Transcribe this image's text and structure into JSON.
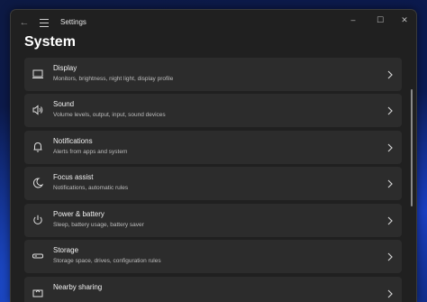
{
  "window": {
    "title": "Settings",
    "back_glyph": "←",
    "min_glyph": "–",
    "max_glyph": "☐",
    "close_glyph": "✕"
  },
  "page": {
    "title": "System"
  },
  "items": [
    {
      "title": "Display",
      "subtitle": "Monitors, brightness, night light, display profile",
      "icon": "display-icon"
    },
    {
      "title": "Sound",
      "subtitle": "Volume levels, output, input, sound devices",
      "icon": "speaker-icon"
    },
    {
      "title": "Notifications",
      "subtitle": "Alerts from apps and system",
      "icon": "bell-icon"
    },
    {
      "title": "Focus assist",
      "subtitle": "Notifications, automatic rules",
      "icon": "moon-icon"
    },
    {
      "title": "Power & battery",
      "subtitle": "Sleep, battery usage, battery saver",
      "icon": "power-icon"
    },
    {
      "title": "Storage",
      "subtitle": "Storage space, drives, configuration rules",
      "icon": "storage-icon"
    },
    {
      "title": "Nearby sharing",
      "subtitle": "",
      "icon": "share-icon"
    }
  ],
  "colors": {
    "window_bg": "#202020",
    "card_bg": "#2c2c2c",
    "desktop_accent": "#1e4fd8"
  }
}
